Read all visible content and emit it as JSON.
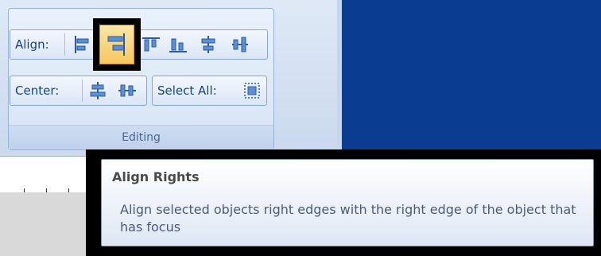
{
  "ribbon": {
    "group_caption": "Editing",
    "align_label": "Align:",
    "center_label": "Center:",
    "select_all_label": "Select All:",
    "align_buttons": [
      {
        "icon": "align-lefts-icon"
      },
      {
        "icon": "align-rights-icon",
        "selected": true
      },
      {
        "icon": "align-tops-icon"
      },
      {
        "icon": "align-bottoms-icon"
      },
      {
        "icon": "align-middles-icon"
      },
      {
        "icon": "align-centers-icon"
      }
    ],
    "center_buttons": [
      {
        "icon": "center-horizontally-icon"
      },
      {
        "icon": "center-vertically-icon"
      }
    ],
    "select_all_button": {
      "icon": "select-all-icon"
    }
  },
  "tooltip": {
    "title": "Align Rights",
    "body": "Align selected objects right edges with the right edge of the object that has focus"
  },
  "colors": {
    "accent": "#15428b",
    "dark_panel": "#0a3d91",
    "highlight": "#f7c75c"
  }
}
